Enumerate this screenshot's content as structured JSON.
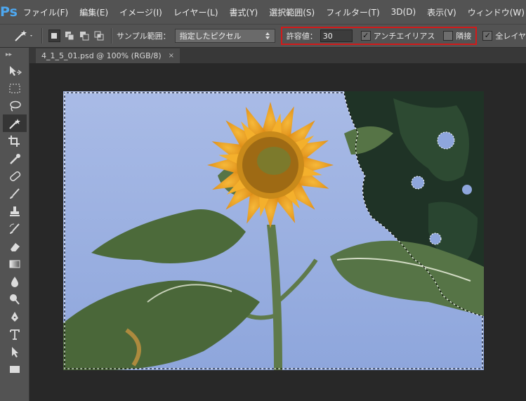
{
  "app": {
    "logo": "Ps"
  },
  "menu": {
    "items": [
      "ファイル(F)",
      "編集(E)",
      "イメージ(I)",
      "レイヤー(L)",
      "書式(Y)",
      "選択範囲(S)",
      "フィルター(T)",
      "3D(D)",
      "表示(V)",
      "ウィンドウ(W)"
    ]
  },
  "options": {
    "tool_icon": "magic-wand-icon",
    "sample_label": "サンプル範囲：",
    "sample_value": "指定したピクセル",
    "tolerance_label": "許容値：",
    "tolerance_value": "30",
    "antialias_label": "アンチエイリアス",
    "antialias_checked": true,
    "contiguous_label": "隣接",
    "contiguous_checked": false,
    "all_layers_label": "全レイヤ",
    "all_layers_checked": true
  },
  "document": {
    "tab_title": "4_1_5_01.psd @ 100% (RGB/8)",
    "close_glyph": "×"
  },
  "colors": {
    "accent_highlight": "#d21a1a",
    "ui_panel": "#535353",
    "canvas_bg": "#282828",
    "ps_blue": "#4ea8f0"
  }
}
